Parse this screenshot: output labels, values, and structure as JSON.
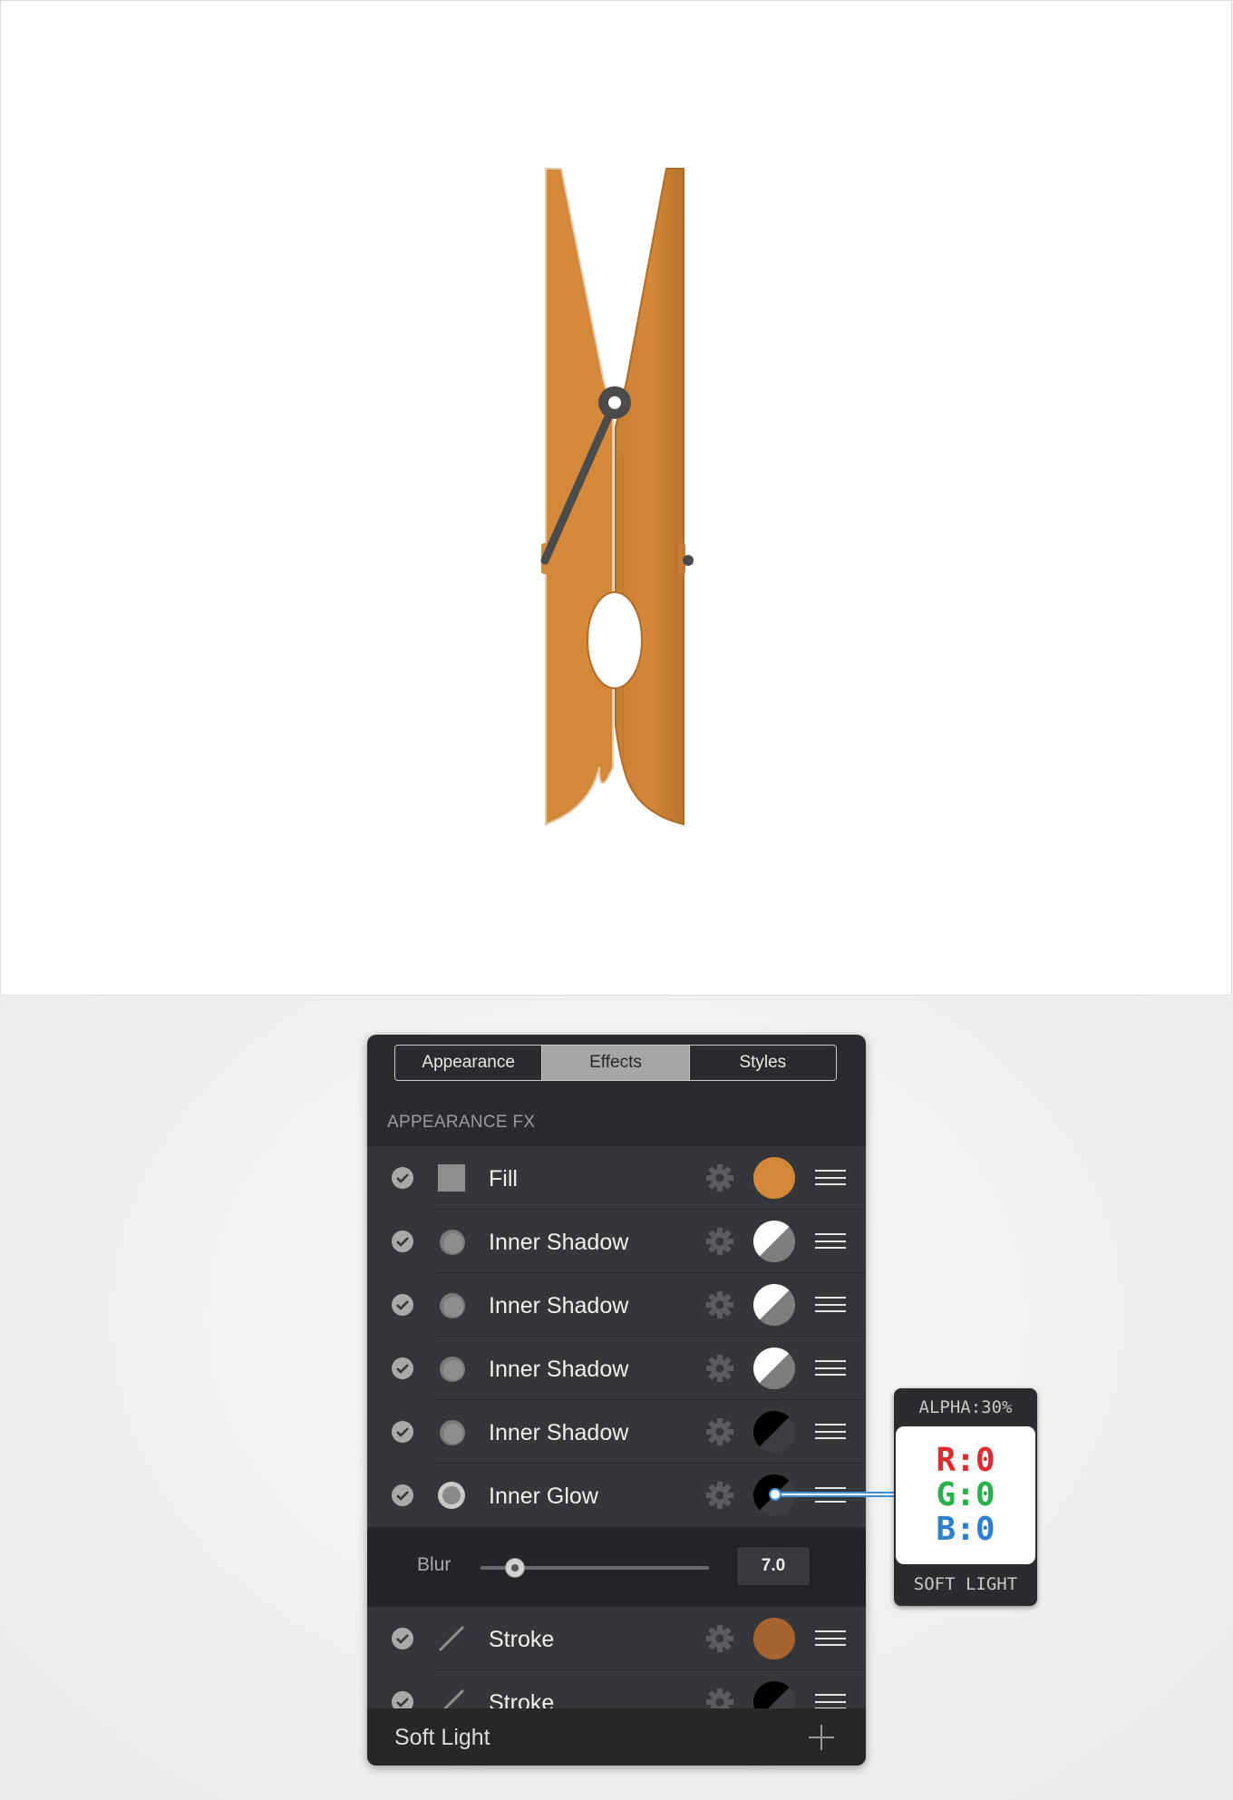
{
  "canvas": {
    "subject": "clothespin illustration"
  },
  "panel": {
    "tabs": [
      {
        "label": "Appearance",
        "active": false
      },
      {
        "label": "Effects",
        "active": true
      },
      {
        "label": "Styles",
        "active": false
      }
    ],
    "section_title": "APPEARANCE FX",
    "effects": [
      {
        "label": "Fill",
        "icon": "square-icon",
        "swatch": "#d4883a",
        "swatch_style": "solid"
      },
      {
        "label": "Inner Shadow",
        "icon": "inner-shadow-icon",
        "swatch_style": "white-gray"
      },
      {
        "label": "Inner Shadow",
        "icon": "inner-shadow-icon",
        "swatch_style": "white-gray"
      },
      {
        "label": "Inner Shadow",
        "icon": "inner-shadow-icon",
        "swatch_style": "white-gray"
      },
      {
        "label": "Inner Shadow",
        "icon": "inner-shadow-icon",
        "swatch_style": "black-gray"
      },
      {
        "label": "Inner Glow",
        "icon": "inner-glow-icon",
        "swatch_style": "black-gray"
      }
    ],
    "blur": {
      "label": "Blur",
      "value": "7.0",
      "fraction": 0.15
    },
    "strokes": [
      {
        "label": "Stroke",
        "icon": "stroke-icon",
        "swatch": "#a8642f",
        "swatch_style": "solid"
      },
      {
        "label": "Stroke",
        "icon": "stroke-icon",
        "swatch_style": "black-gray"
      }
    ],
    "footer": {
      "blend_mode": "Soft Light"
    }
  },
  "callout": {
    "alpha": "ALPHA:30%",
    "r": "R:0",
    "g": "G:0",
    "b": "B:0",
    "mode": "SOFT LIGHT"
  },
  "colors": {
    "clothespin": "#d4883a",
    "spring": "#4b4b4b",
    "panel_bg": "#2a2b2e",
    "r": "#e02a2e",
    "g": "#28b04a",
    "b": "#2f7fd1",
    "connector": "#3a8fd6"
  }
}
